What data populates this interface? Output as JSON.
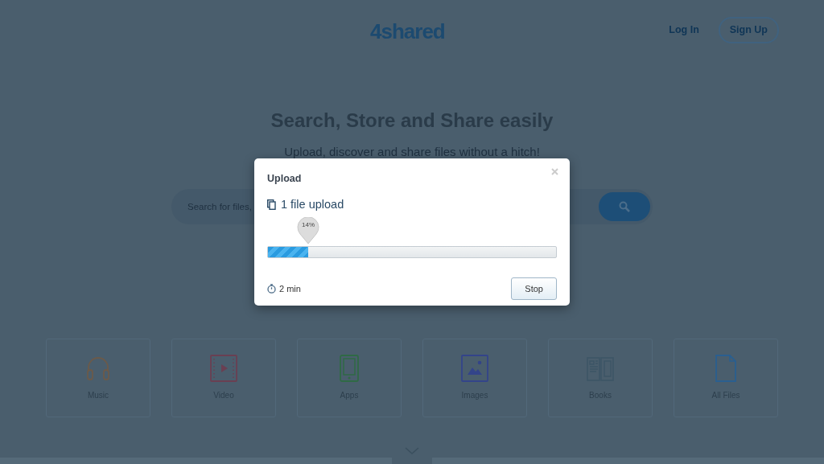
{
  "header": {
    "logo": "4shared",
    "login": "Log In",
    "signup": "Sign Up"
  },
  "hero": {
    "title": "Search, Store and Share easily",
    "subtitle": "Upload, discover and share files without a hitch!"
  },
  "search": {
    "placeholder": "Search for files,"
  },
  "categories": [
    {
      "label": "Music",
      "kind": "music"
    },
    {
      "label": "Video",
      "kind": "video"
    },
    {
      "label": "Apps",
      "kind": "apps"
    },
    {
      "label": "Images",
      "kind": "images"
    },
    {
      "label": "Books",
      "kind": "books"
    },
    {
      "label": "All Files",
      "kind": "files"
    }
  ],
  "dialog": {
    "title": "Upload",
    "heading": "1 file upload",
    "level": 0.14,
    "percent": "14%",
    "time": "2 min",
    "stop": "Stop"
  }
}
